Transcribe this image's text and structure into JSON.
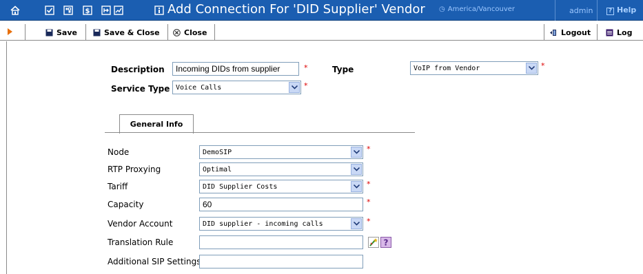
{
  "header": {
    "title": "Add Connection For 'DID Supplier' Vendor",
    "timezone": "America/Vancouver",
    "user": "admin",
    "help": "Help",
    "icons": [
      "home-icon",
      "checkbox-icon",
      "grid-icon",
      "dollar-icon",
      "export-icon",
      "chart-icon",
      "info-icon"
    ]
  },
  "toolbar": {
    "save": "Save",
    "save_close": "Save & Close",
    "close": "Close",
    "logout": "Logout",
    "log": "Log"
  },
  "form": {
    "description_label": "Description",
    "description_value": "Incoming DIDs from supplier",
    "type_label": "Type",
    "type_value": "VoIP from Vendor",
    "service_type_label": "Service Type",
    "service_type_value": "Voice Calls",
    "required_mark": "*"
  },
  "tabs": [
    {
      "label": "General Info"
    }
  ],
  "general": {
    "node_label": "Node",
    "node_value": "DemoSIP",
    "rtp_label": "RTP Proxying",
    "rtp_value": "Optimal",
    "tariff_label": "Tariff",
    "tariff_value": "DID Supplier Costs",
    "capacity_label": "Capacity",
    "capacity_value": "60",
    "vendor_account_label": "Vendor Account",
    "vendor_account_value": "DID supplier - incoming calls",
    "translation_rule_label": "Translation Rule",
    "translation_rule_value": "",
    "additional_sip_label": "Additional SIP Settings",
    "additional_sip_value": ""
  },
  "colors": {
    "header_bg": "#1b5eb1",
    "timezone_text": "#9cc7ff",
    "required": "#dd0000",
    "input_border": "#7f9db9",
    "select_arrow_bg": "#c9d8f5"
  }
}
